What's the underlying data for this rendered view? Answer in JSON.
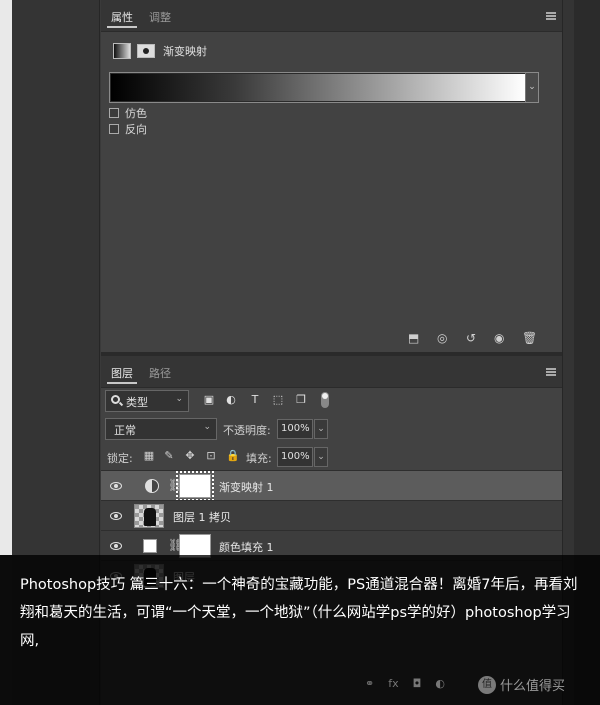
{
  "properties_panel": {
    "tabs": [
      "属性",
      "调整"
    ],
    "adjustment_title": "渐变映射",
    "gradient_dropdown_icon": "chevron-down-icon",
    "dither_label": "仿色",
    "reverse_label": "反向"
  },
  "layers_panel": {
    "tabs": [
      "图层",
      "路径"
    ],
    "filter_kind": "类型",
    "blend_mode": "正常",
    "opacity_label": "不透明度:",
    "opacity_value": "100%",
    "lock_label": "锁定:",
    "fill_label": "填充:",
    "fill_value": "100%",
    "layers": [
      {
        "name": "渐变映射 1",
        "selected": true,
        "type": "adjustment"
      },
      {
        "name": "图层 1 拷贝",
        "selected": false,
        "type": "image"
      },
      {
        "name": "颜色填充 1",
        "selected": false,
        "type": "fill"
      },
      {
        "name": "图层",
        "selected": false,
        "type": "image"
      }
    ]
  },
  "overlay": {
    "text": "Photoshop技巧 篇三十六：一个神奇的宝藏功能，PS通道混合器！离婚7年后，再看刘翔和葛天的生活，可谓“一个天堂，一个地狱”（什么网站学ps学的好）photoshop学习网,"
  },
  "watermark": {
    "text": "什么值得买",
    "icon_text": "值"
  },
  "colors": {
    "panel_bg": "#424242",
    "selected_layer": "#5c5c5c",
    "overlay_bg": "#000000"
  }
}
